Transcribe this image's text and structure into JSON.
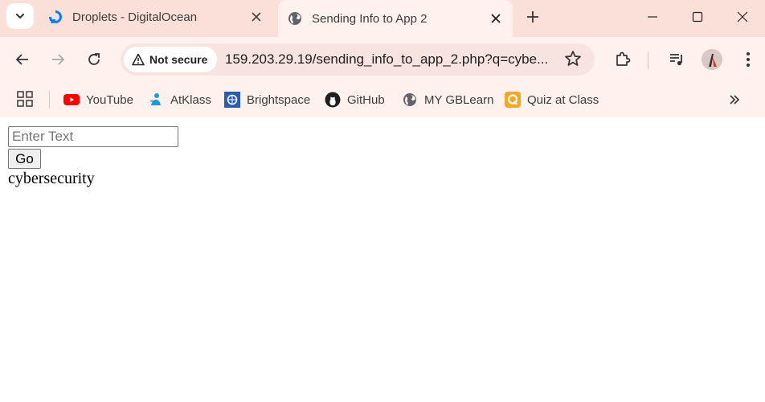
{
  "tabs": [
    {
      "title": "Droplets - DigitalOcean",
      "favicon": "digitalocean-icon",
      "active": false
    },
    {
      "title": "Sending Info to App 2",
      "favicon": "globe-icon",
      "active": true
    }
  ],
  "toolbar": {
    "security_label": "Not secure",
    "url": "159.203.29.19/sending_info_to_app_2.php?q=cybe..."
  },
  "bookmarks": [
    {
      "label": "YouTube",
      "icon": "youtube-icon"
    },
    {
      "label": "AtKlass",
      "icon": "atklass-icon"
    },
    {
      "label": "Brightspace",
      "icon": "brightspace-icon"
    },
    {
      "label": "GitHub",
      "icon": "github-icon"
    },
    {
      "label": "MY GBLearn",
      "icon": "globe-icon"
    },
    {
      "label": "Quiz at Class",
      "icon": "quiz-icon"
    }
  ],
  "page": {
    "input_placeholder": "Enter Text",
    "input_value": "",
    "button_label": "Go",
    "result": "cybersecurity"
  },
  "colors": {
    "tabstrip_bg": "#fbe0d9",
    "toolbar_bg": "#fff1ee",
    "omnibox_bg": "#f7e3df",
    "youtube_red": "#ff0000",
    "digitalocean_blue": "#0080ff",
    "quiz_orange": "#f5a623"
  }
}
